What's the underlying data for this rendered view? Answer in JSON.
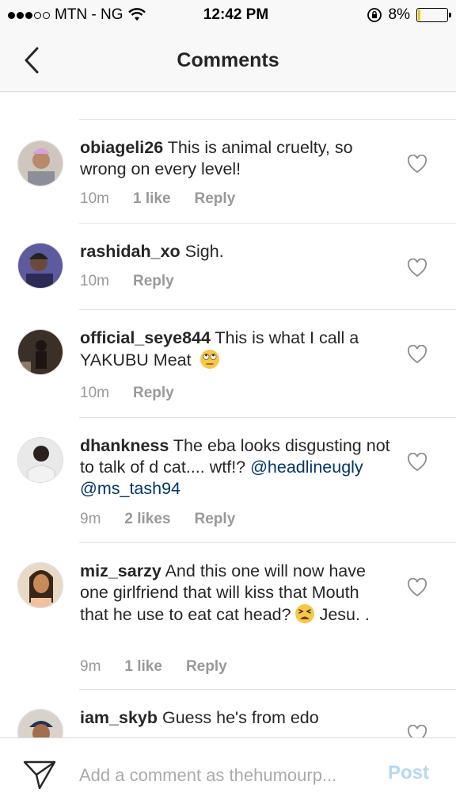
{
  "status_bar": {
    "carrier": "MTN - NG",
    "time": "12:42 PM",
    "battery": "8%",
    "battery_level": 0.08
  },
  "header": {
    "title": "Comments"
  },
  "comments": [
    {
      "username": "obiageli26",
      "text": "This is animal cruelty, so wrong on every level!",
      "time": "10m",
      "likes": "1 like",
      "reply": "Reply"
    },
    {
      "username": "rashidah_xo",
      "text": "Sigh.",
      "time": "10m",
      "likes": "",
      "reply": "Reply"
    },
    {
      "username": "official_seye844",
      "text": "This is what I call a YAKUBU Meat",
      "emoji": "face-with-rolling-eyes",
      "time": "10m",
      "likes": "",
      "reply": "Reply"
    },
    {
      "username": "dhankness",
      "text": "The eba looks disgusting not to talk of d cat.... wtf!?",
      "mentions": [
        "@headlineugly",
        "@ms_tash94"
      ],
      "time": "9m",
      "likes": "2 likes",
      "reply": "Reply"
    },
    {
      "username": "miz_sarzy",
      "text": "And this one will now have one girlfriend that will kiss that Mouth that he use to eat cat head?",
      "emoji": "tired-face",
      "text_after": "Jesu. .",
      "time": "9m",
      "likes": "1 like",
      "reply": "Reply"
    },
    {
      "username": "iam_skyb",
      "text": "Guess he's from edo"
    }
  ],
  "composer": {
    "placeholder": "Add a comment as thehumourp...",
    "post_label": "Post"
  },
  "colors": {
    "mention": "#003569",
    "meta": "#999999",
    "post_disabled": "#b6d7f5"
  }
}
